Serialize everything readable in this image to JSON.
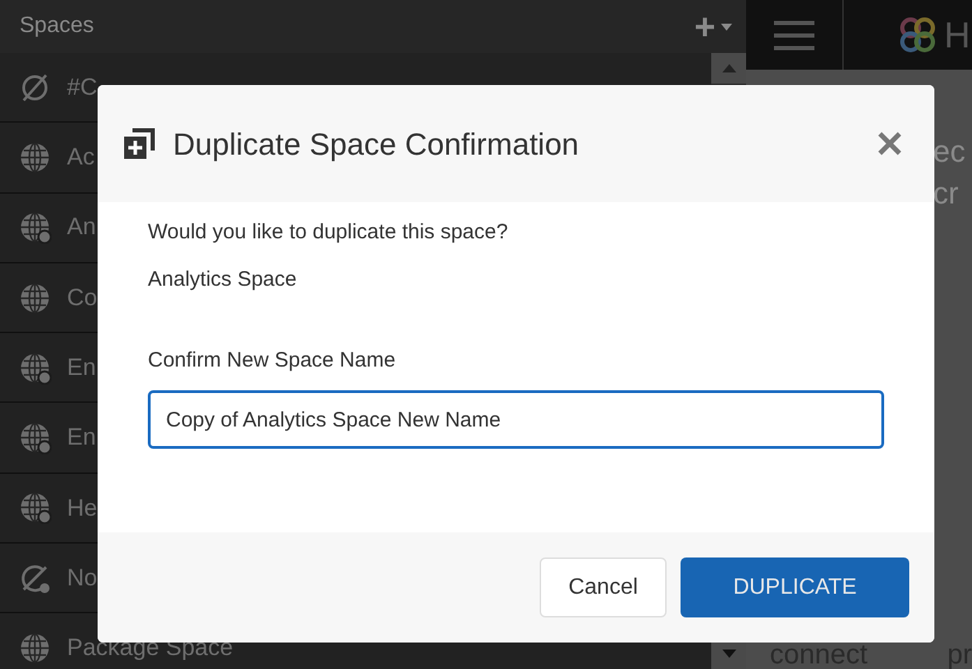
{
  "sidebar": {
    "title": "Spaces",
    "add_label": "+",
    "items": [
      {
        "label": "#C",
        "kind": "empty"
      },
      {
        "label": "Ac",
        "kind": "globe"
      },
      {
        "label": "An",
        "kind": "globe-dot"
      },
      {
        "label": "Co",
        "kind": "globe"
      },
      {
        "label": "En",
        "kind": "globe-dot"
      },
      {
        "label": "En",
        "kind": "globe-dot"
      },
      {
        "label": "He",
        "kind": "globe-dot"
      },
      {
        "label": "No",
        "kind": "broken"
      },
      {
        "label": "Package Space",
        "kind": "globe"
      }
    ]
  },
  "header": {
    "brand": "H"
  },
  "background_texts": [
    "ec",
    "cr"
  ],
  "background_bottom": [
    "connect",
    "pr"
  ],
  "dialog": {
    "title": "Duplicate Space Confirmation",
    "question": "Would you like to duplicate this space?",
    "space_name": "Analytics Space",
    "field_label": "Confirm New Space Name",
    "field_value": "Copy of Analytics Space New Name",
    "buttons": [
      {
        "label": "Cancel",
        "kind": "secondary"
      },
      {
        "label": "DUPLICATE",
        "kind": "primary"
      }
    ]
  }
}
